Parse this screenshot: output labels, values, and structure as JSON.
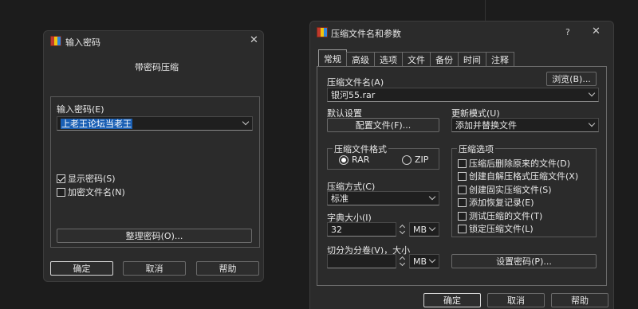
{
  "password_dialog": {
    "title": "输入密码",
    "subtitle": "带密码压缩",
    "field_label": "输入密码(E)",
    "password_value": "上老王论坛当老王",
    "show_password_label": "显示密码(S)",
    "encrypt_names_label": "加密文件名(N)",
    "organize_button": "整理密码(O)...",
    "ok_button": "确定",
    "cancel_button": "取消",
    "help_button": "帮助",
    "show_password_checked": true,
    "encrypt_names_checked": false
  },
  "archive_dialog": {
    "title": "压缩文件名和参数",
    "help_glyph": "?",
    "close_glyph": "✕",
    "tabs": [
      "常规",
      "高级",
      "选项",
      "文件",
      "备份",
      "时间",
      "注释"
    ],
    "active_tab": "常规",
    "archive_name_label": "压缩文件名(A)",
    "browse_button": "浏览(B)...",
    "archive_name_value": "银河55.rar",
    "default_settings_label": "默认设置",
    "profiles_button": "配置文件(F)...",
    "update_mode_label": "更新模式(U)",
    "update_mode_value": "添加并替换文件",
    "format_group_title": "压缩文件格式",
    "format_rar": "RAR",
    "format_zip": "ZIP",
    "format_selected": "RAR",
    "method_label": "压缩方式(C)",
    "method_value": "标准",
    "dict_label": "字典大小(I)",
    "dict_value": "32",
    "dict_unit": "MB",
    "split_label": "切分为分卷(V)，大小",
    "split_value": "",
    "split_unit": "MB",
    "options_group_title": "压缩选项",
    "options": [
      {
        "label": "压缩后删除原来的文件(D)",
        "checked": false
      },
      {
        "label": "创建自解压格式压缩文件(X)",
        "checked": false
      },
      {
        "label": "创建固实压缩文件(S)",
        "checked": false
      },
      {
        "label": "添加恢复记录(E)",
        "checked": false
      },
      {
        "label": "测试压缩的文件(T)",
        "checked": false
      },
      {
        "label": "锁定压缩文件(L)",
        "checked": false
      }
    ],
    "set_password_button": "设置密码(P)...",
    "ok_button": "确定",
    "cancel_button": "取消",
    "help_button": "帮助"
  },
  "icons": {
    "app_icon": "winrar-icon",
    "close_icon": "close-icon",
    "dropdown_icon": "chevron-down-icon"
  }
}
